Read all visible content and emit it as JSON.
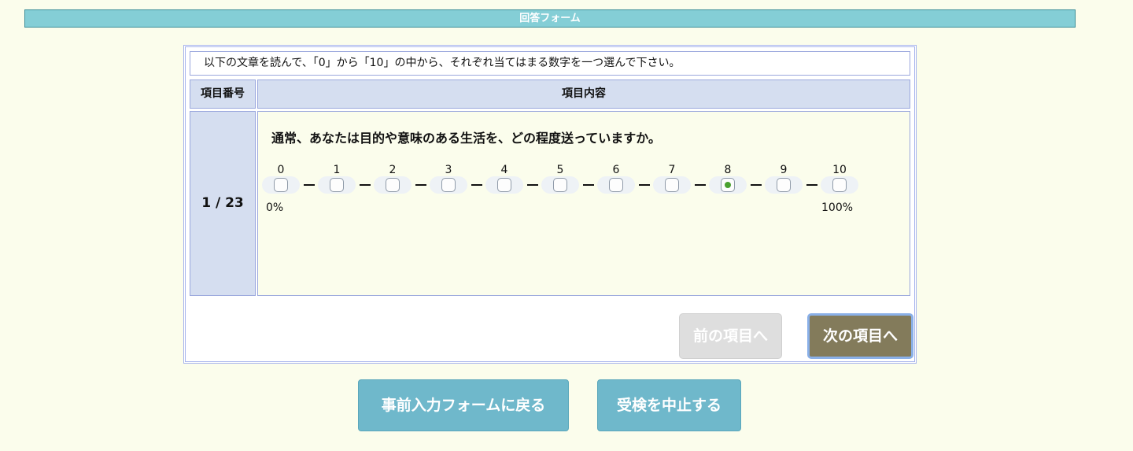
{
  "header": {
    "title": "回答フォーム"
  },
  "form": {
    "instruction": "以下の文章を読んで、「0」から「10」の中から、それぞれ当てはまる数字を一つ選んで下さい。",
    "columns": {
      "number": "項目番号",
      "content": "項目内容"
    },
    "item": {
      "number": "1 / 23",
      "question": "通常、あなたは目的や意味のある生活を、どの程度送っていますか。",
      "scale": {
        "labels": [
          "0",
          "1",
          "2",
          "3",
          "4",
          "5",
          "6",
          "7",
          "8",
          "9",
          "10"
        ],
        "selected": 8,
        "low_label": "0%",
        "high_label": "100%"
      }
    },
    "nav": {
      "prev_label": "前の項目へ",
      "next_label": "次の項目へ"
    }
  },
  "footer": {
    "back_label": "事前入力フォームに戻る",
    "quit_label": "受検を中止する"
  },
  "colors": {
    "page_bg": "#fbfdec",
    "header_bg": "#84ced6",
    "table_header_bg": "#d5def0",
    "selected_dot": "#4aa12f",
    "next_button_bg": "#837b5b",
    "footer_button_bg": "#6fb8cb"
  }
}
